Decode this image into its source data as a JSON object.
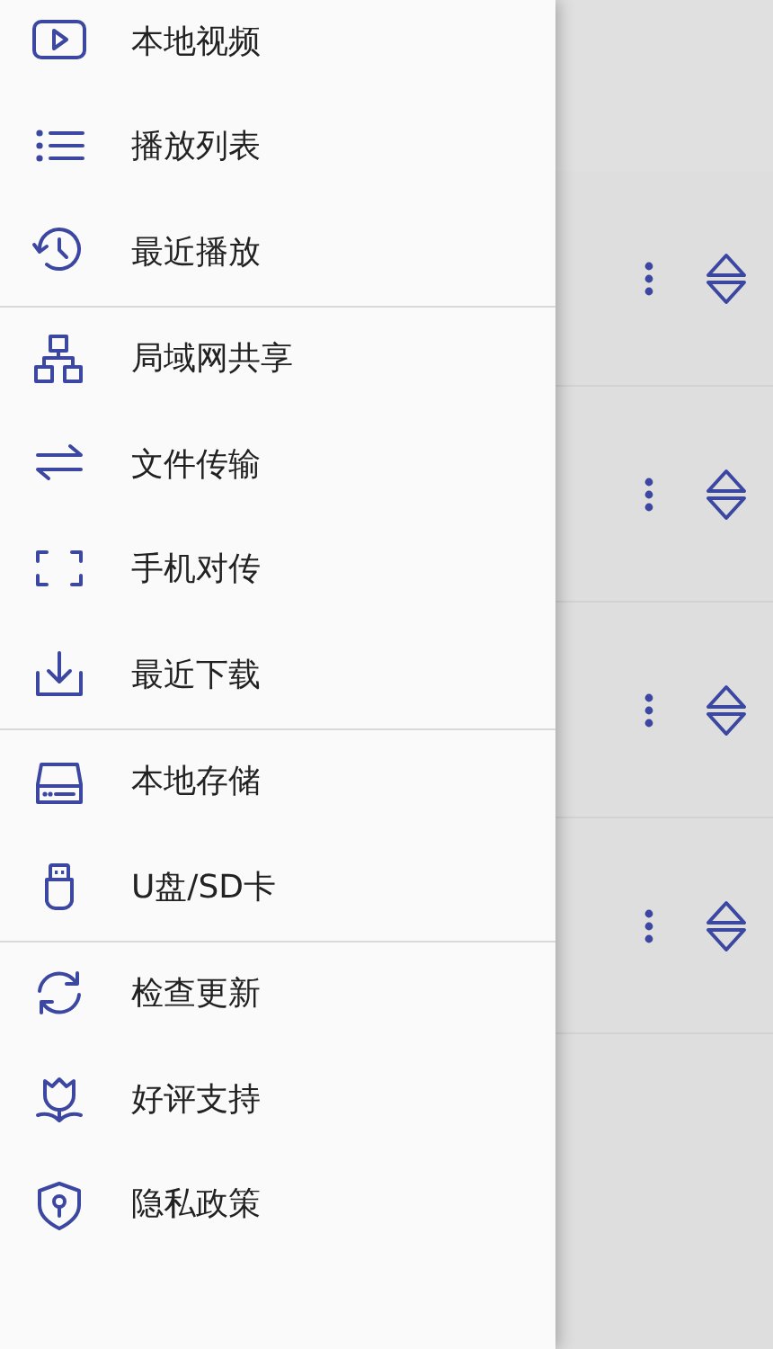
{
  "drawer": {
    "groups": [
      {
        "items": [
          {
            "kind": "video",
            "label": "本地视频"
          },
          {
            "kind": "list",
            "label": "播放列表"
          },
          {
            "kind": "history",
            "label": "最近播放"
          }
        ]
      },
      {
        "items": [
          {
            "kind": "network",
            "label": "局域网共享"
          },
          {
            "kind": "transfer",
            "label": "文件传输"
          },
          {
            "kind": "scan",
            "label": "手机对传"
          },
          {
            "kind": "download",
            "label": "最近下载"
          }
        ]
      },
      {
        "items": [
          {
            "kind": "drive",
            "label": "本地存储"
          },
          {
            "kind": "usb",
            "label": "U盘/SD卡"
          }
        ]
      },
      {
        "items": [
          {
            "kind": "refresh",
            "label": "检查更新"
          },
          {
            "kind": "flower",
            "label": "好评支持"
          },
          {
            "kind": "shield",
            "label": "隐私政策"
          }
        ]
      }
    ]
  },
  "background_rows": [
    {
      "kind": "playlist"
    },
    {
      "kind": "playlist"
    },
    {
      "kind": "playlist"
    },
    {
      "kind": "playlist"
    }
  ]
}
